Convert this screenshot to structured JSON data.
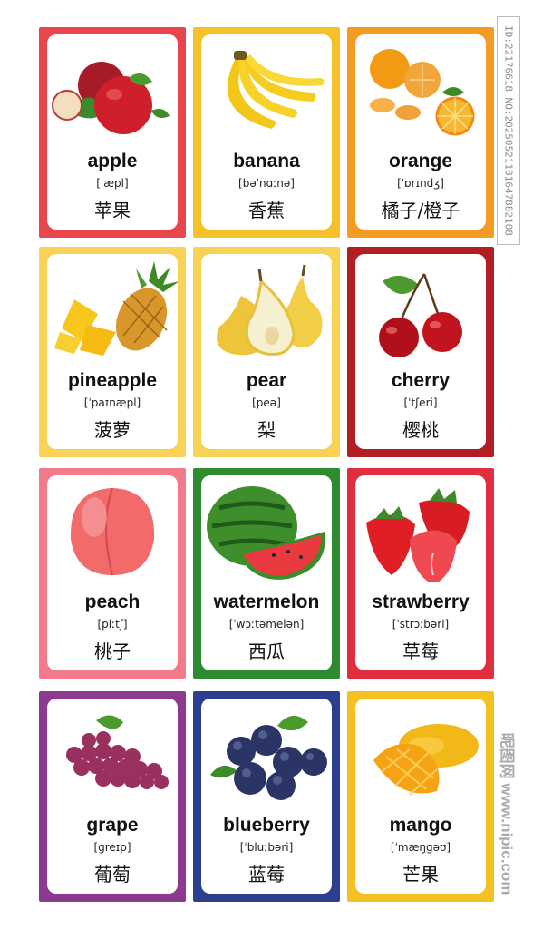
{
  "cards": [
    {
      "word": "apple",
      "ipa": "[ˈæpl]",
      "cn": "苹果",
      "border": "#e8464c",
      "fruit": "apple"
    },
    {
      "word": "banana",
      "ipa": "[bəˈnɑːnə]",
      "cn": "香蕉",
      "border": "#f5c12a",
      "fruit": "banana"
    },
    {
      "word": "orange",
      "ipa": "[ˈɒrɪndʒ]",
      "cn": "橘子/橙子",
      "border": "#f59a23",
      "fruit": "orange"
    },
    {
      "word": "pineapple",
      "ipa": "[ˈpaɪnæpl]",
      "cn": "菠萝",
      "border": "#f9d257",
      "fruit": "pineapple"
    },
    {
      "word": "pear",
      "ipa": "[peə]",
      "cn": "梨",
      "border": "#f7d255",
      "fruit": "pear"
    },
    {
      "word": "cherry",
      "ipa": "[ˈtʃeri]",
      "cn": "樱桃",
      "border": "#b21e24",
      "fruit": "cherry"
    },
    {
      "word": "peach",
      "ipa": "[piːtʃ]",
      "cn": "桃子",
      "border": "#f27a8a",
      "fruit": "peach"
    },
    {
      "word": "watermelon",
      "ipa": "[ˈwɔːtəmelən]",
      "cn": "西瓜",
      "border": "#2e8b2e",
      "fruit": "watermelon"
    },
    {
      "word": "strawberry",
      "ipa": "[ˈstrɔːbəri]",
      "cn": "草莓",
      "border": "#e02e3e",
      "fruit": "strawberry"
    },
    {
      "word": "grape",
      "ipa": "[greɪp]",
      "cn": "葡萄",
      "border": "#8b3a8f",
      "fruit": "grape"
    },
    {
      "word": "blueberry",
      "ipa": "[ˈbluːbəri]",
      "cn": "蓝莓",
      "border": "#2c3e8f",
      "fruit": "blueberry"
    },
    {
      "word": "mango",
      "ipa": "[ˈmæŋgəʊ]",
      "cn": "芒果",
      "border": "#f5c021",
      "fruit": "mango"
    }
  ],
  "watermark": {
    "id_text": "ID:22176618 NO:20250521181647882108",
    "site_text": "昵图网 www.nipic.com"
  }
}
